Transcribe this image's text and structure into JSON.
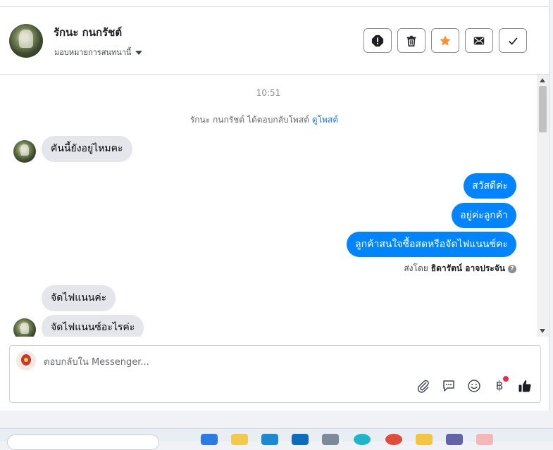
{
  "header": {
    "contact_name": "รักนะ กนกรัชต์",
    "assign_label": "มอบหมายการสนทนานี้",
    "actions": [
      "spam-icon",
      "trash-icon",
      "star-icon",
      "mail-icon",
      "check-icon"
    ]
  },
  "thread": {
    "timestamp": "10:51",
    "system_message": "รักนะ กนกรัชต์ ได้ตอบกลับโพสต์",
    "system_link": "ดูโพสต์",
    "incoming_first": "คันนี้ยังอยู่ไหมคะ",
    "outgoing": [
      "สวัสดีค่ะ",
      "อยู่ค่ะลูกค้า",
      "ลูกค้าสนใจซื้อสดหรือจัดไฟแนนซ์คะ"
    ],
    "sent_by_prefix": "ส่งโดย",
    "sent_by_name": "ธิดารัตน์ อาจประจัน",
    "incoming_later": [
      "จัดไฟแนนค่ะ",
      "จัดไฟแนนซ์อะไรค่ะ"
    ]
  },
  "composer": {
    "placeholder": "ตอบกลับใน Messenger...",
    "value": "",
    "tools": [
      "paperclip-icon",
      "quick-reply-icon",
      "emoji-icon",
      "baht-icon",
      "thumbs-up-icon"
    ],
    "baht_symbol": "฿"
  },
  "colors": {
    "outgoing_bubble": "#0084ff",
    "incoming_bubble": "#e4e6eb",
    "link": "#1877f2",
    "star": "#f7923a"
  }
}
